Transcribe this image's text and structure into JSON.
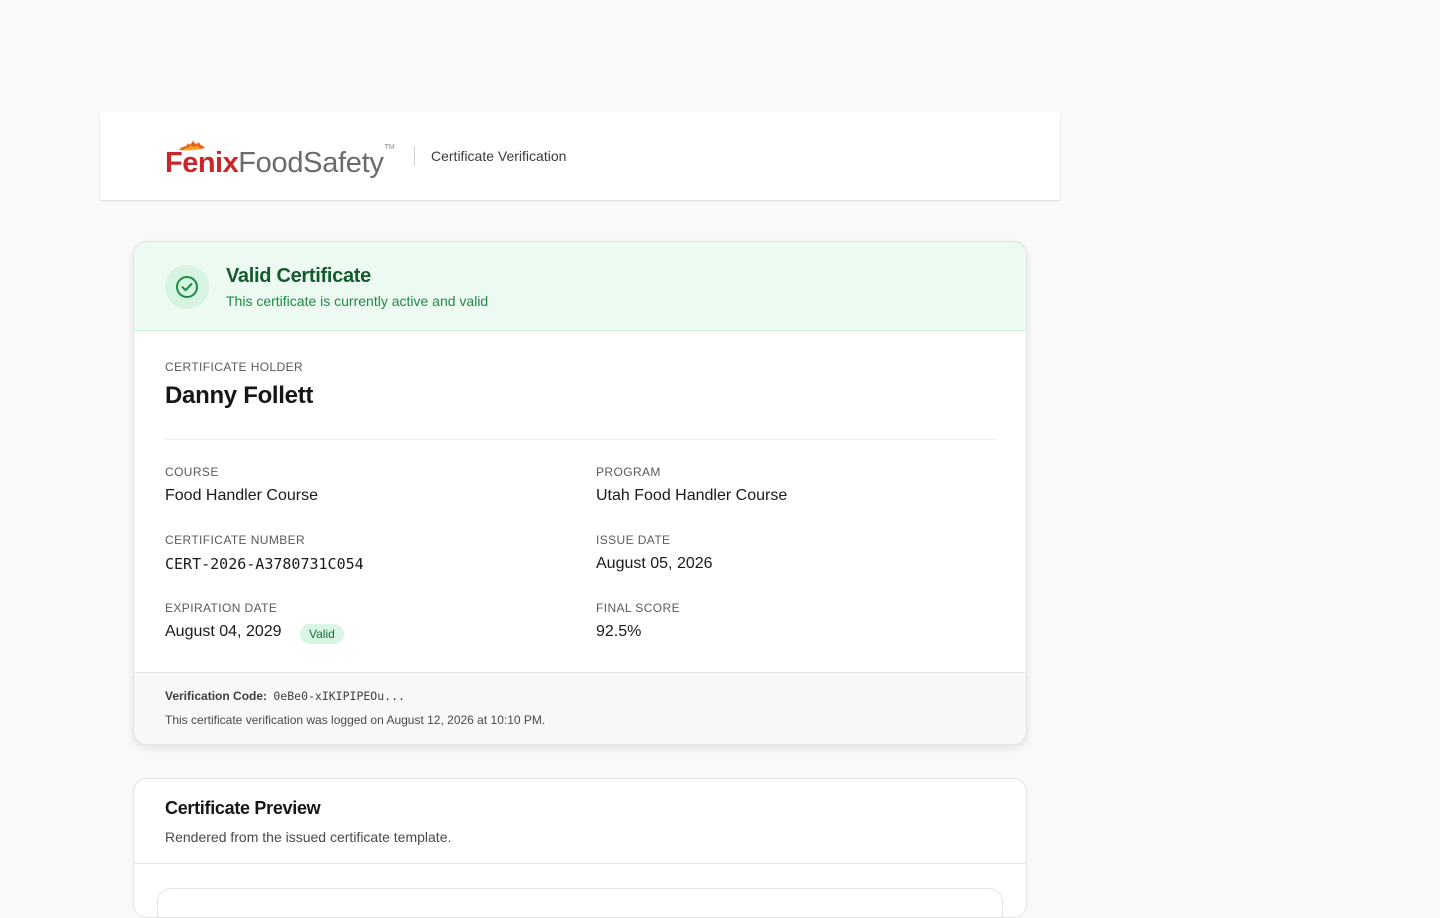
{
  "header": {
    "logo_primary": "Fenix",
    "logo_secondary": "FoodSafety",
    "logo_tm": "TM",
    "title": "Certificate Verification"
  },
  "status": {
    "title": "Valid Certificate",
    "subtitle": "This certificate is currently active and valid",
    "icon": "check-circle-icon",
    "color": "#1f8a45"
  },
  "holder": {
    "label": "CERTIFICATE HOLDER",
    "name": "Danny Follett"
  },
  "details": {
    "course_label": "COURSE",
    "course": "Food Handler Course",
    "program_label": "PROGRAM",
    "program": "Utah Food Handler Course",
    "cert_number_label": "CERTIFICATE NUMBER",
    "cert_number": "CERT-2026-A3780731C054",
    "issue_date_label": "ISSUE DATE",
    "issue_date": "August 05, 2026",
    "expiration_label": "EXPIRATION DATE",
    "expiration": "August 04, 2029",
    "expiration_badge": "Valid",
    "score_label": "FINAL SCORE",
    "score": "92.5%"
  },
  "footer": {
    "code_label": "Verification Code:",
    "code_value": "0eBe0-xIKIPIPEOu...",
    "logged": "This certificate verification was logged on August 12, 2026 at 10:10 PM."
  },
  "preview": {
    "title": "Certificate Preview",
    "subtitle": "Rendered from the issued certificate template."
  },
  "colors": {
    "brand_red": "#c8272c",
    "brand_gray": "#6b6b6b",
    "success_bg": "#ecfaf1",
    "success_text": "#145a2e"
  }
}
